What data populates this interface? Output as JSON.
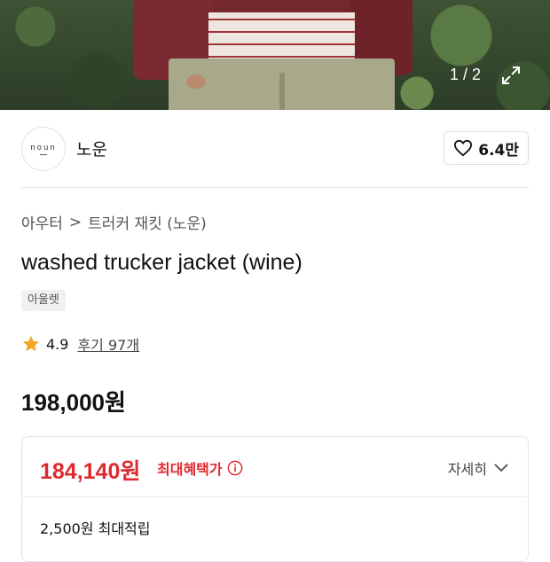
{
  "hero": {
    "counter": "1 / 2"
  },
  "brand": {
    "logo_text": "noun",
    "name": "노운",
    "like_count": "6.4만"
  },
  "breadcrumb": {
    "category": "아우터",
    "separator": ">",
    "subcategory": "트러커 재킷 (노운)"
  },
  "product": {
    "title": "washed trucker jacket (wine)",
    "tag": "아울렛",
    "rating": "4.9",
    "review_label": "후기 97개",
    "price": "198,000원"
  },
  "benefit": {
    "max_price": "184,140원",
    "max_label": "최대혜택가",
    "detail_label": "자세히",
    "points": "2,500원 최대적립"
  },
  "colors": {
    "accent_red": "#e0282f",
    "star": "#f5a623"
  }
}
